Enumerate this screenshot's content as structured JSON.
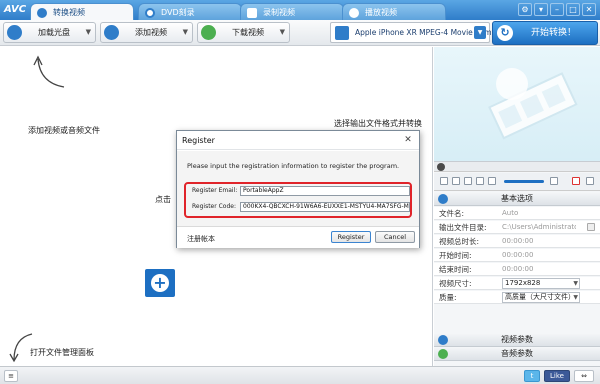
{
  "app": {
    "logo": "AVC"
  },
  "tabs": [
    {
      "label": "转换视频",
      "active": true
    },
    {
      "label": "DVD刻录",
      "active": false
    },
    {
      "label": "录制视频",
      "active": false
    },
    {
      "label": "播放视频",
      "active": false
    }
  ],
  "toolbar": {
    "load_disc": "加载光盘",
    "add_video": "添加视频",
    "download_video": "下载视频",
    "format": "Apple iPhone XR MPEG-4 Movie (*.m...",
    "convert": "开始转换！"
  },
  "main": {
    "hint_add": "添加视频或音频文件",
    "hint_output": "选择输出文件格式并转换",
    "hint_click": "点击",
    "hint_file_manager": "打开文件管理面板"
  },
  "right": {
    "basic_options": "基本选项",
    "props": [
      {
        "key": "文件名:",
        "value": "Auto"
      },
      {
        "key": "输出文件目录:",
        "value": "C:\\Users\\Administrator\\..."
      },
      {
        "key": "视频总时长:",
        "value": "00:00:00"
      },
      {
        "key": "开始时间:",
        "value": "00:00:00"
      },
      {
        "key": "结束时间:",
        "value": "00:00:00"
      },
      {
        "key": "视频尺寸:",
        "value": "1792x828"
      },
      {
        "key": "质量:",
        "value": "高质量（大尺寸文件）"
      }
    ],
    "video_params": "视频参数",
    "audio_params": "音频参数"
  },
  "dialog": {
    "title": "Register",
    "close": "✕",
    "message": "Please input the registration information to register the program.",
    "email_label": "Register Email:",
    "email_value": "PortableAppZ",
    "code_label": "Register Code:",
    "code_value": "000KX4-QBCXCH-91W6A6-EUXXE1-MSTYU4-MA7SFG-MG8D80",
    "link": "注册帐本",
    "register": "Register",
    "cancel": "Cancel"
  },
  "statusbar": {
    "like": "Like"
  },
  "colors": {
    "accent": "#1d6fc2",
    "highlight": "#e0242a",
    "tab_bar": "#2f7dc9"
  }
}
